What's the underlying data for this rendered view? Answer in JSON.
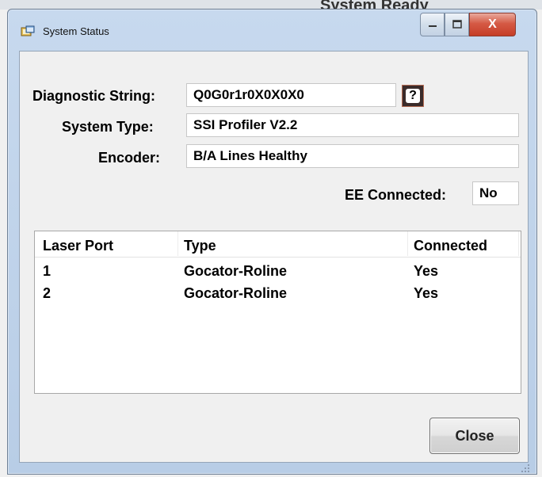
{
  "background": {
    "partial_title": "System Ready"
  },
  "window": {
    "title": "System Status",
    "icon": "app-window-icon",
    "controls": {
      "minimize": "minimize-icon",
      "maximize": "maximize-icon",
      "close": "X"
    }
  },
  "fields": {
    "diagnostic": {
      "label": "Diagnostic String:",
      "value": "Q0G0r1r0X0X0X0"
    },
    "system_type": {
      "label": "System Type:",
      "value": "SSI Profiler V2.2"
    },
    "encoder": {
      "label": "Encoder:",
      "value": "B/A Lines Healthy"
    },
    "ee_connected": {
      "label": "EE Connected:",
      "value": "No"
    }
  },
  "help_button": {
    "label": "?"
  },
  "laser_table": {
    "columns": [
      "Laser Port",
      "Type",
      "Connected"
    ],
    "rows": [
      [
        "1",
        "Gocator-Roline",
        "Yes"
      ],
      [
        "2",
        "Gocator-Roline",
        "Yes"
      ]
    ]
  },
  "close_button": {
    "label": "Close"
  }
}
